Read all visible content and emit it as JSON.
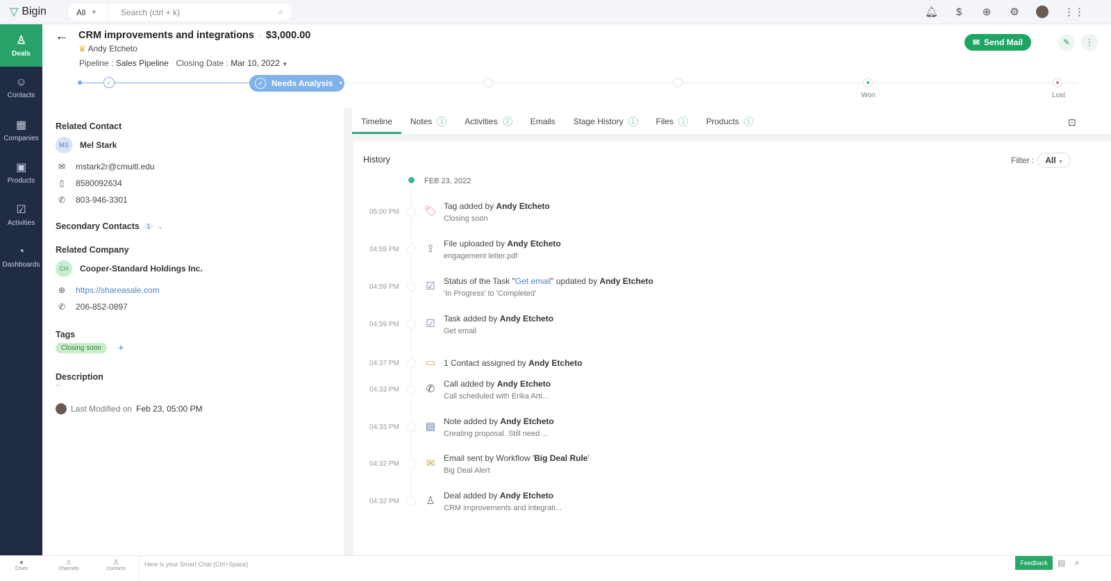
{
  "app": {
    "name": "Bigin",
    "search_scope": "All",
    "search_placeholder": "Search (ctrl + k)"
  },
  "topbar_icons": [
    "bell-icon",
    "currency-icon",
    "add-icon",
    "settings-icon",
    "avatar",
    "apps-grid-icon"
  ],
  "sidebar": {
    "items": [
      {
        "label": "Deals",
        "icon": "deals-icon",
        "active": true
      },
      {
        "label": "Contacts",
        "icon": "contacts-icon"
      },
      {
        "label": "Companies",
        "icon": "companies-icon"
      },
      {
        "label": "Products",
        "icon": "products-icon"
      },
      {
        "label": "Activities",
        "icon": "activities-icon"
      },
      {
        "label": "Dashboards",
        "icon": "dashboards-icon"
      }
    ]
  },
  "deal": {
    "title": "CRM improvements and integrations",
    "amount": "$3,000.00",
    "owner": "Andy Etcheto",
    "pipeline_label": "Pipeline :",
    "pipeline": "Sales Pipeline",
    "closing_label": "Closing Date :",
    "closing_date": "Mar 10, 2022",
    "send_mail": "Send Mail"
  },
  "stages": {
    "current": "Needs Analysis",
    "won": "Won",
    "lost": "Lost",
    "won_color": "#3bb98a",
    "lost_color": "#e46b7e"
  },
  "left": {
    "related_contact": "Related Contact",
    "contact_initials": "MS",
    "contact_name": "Mel Stark",
    "email": "mstark2r@cmuitl.edu",
    "mobile": "8580092634",
    "phone": "803-946-3301",
    "secondary_contacts": "Secondary Contacts",
    "secondary_count": "1",
    "related_company": "Related Company",
    "company_initials": "CH",
    "company_name": "Cooper-Standard Holdings Inc.",
    "website": "https://shareasale.com",
    "company_phone": "206-852-0897",
    "tags_label": "Tags",
    "tag": "Closing soon",
    "description_label": "Description",
    "description": "--",
    "last_modified_label": "Last Modified on",
    "last_modified": "Feb 23, 05:00 PM"
  },
  "tabs": [
    {
      "label": "Timeline",
      "active": true
    },
    {
      "label": "Notes",
      "count": "1"
    },
    {
      "label": "Activities",
      "count": "2"
    },
    {
      "label": "Emails"
    },
    {
      "label": "Stage History",
      "count": "1"
    },
    {
      "label": "Files",
      "count": "1"
    },
    {
      "label": "Products",
      "count": "1"
    }
  ],
  "timeline": {
    "heading": "History",
    "filter_label": "Filter :",
    "filter_value": "All",
    "date": "FEB 23, 2022",
    "entries": [
      {
        "time": "05:00 PM",
        "icon": "tag-icon",
        "pre": "Tag added by ",
        "bold": "Andy Etcheto",
        "sub": "Closing soon"
      },
      {
        "time": "04:59 PM",
        "icon": "file-upload-icon",
        "pre": "File uploaded by ",
        "bold": "Andy Etcheto",
        "sub": "engagement letter.pdf"
      },
      {
        "time": "04:59 PM",
        "icon": "task-icon",
        "pre": "Status of the Task \"",
        "link": "Get email",
        "mid": "\" updated by ",
        "bold": "Andy Etcheto",
        "sub": "'In Progress' to 'Completed'"
      },
      {
        "time": "04:59 PM",
        "icon": "task-icon",
        "pre": "Task added by ",
        "bold": "Andy Etcheto",
        "sub": "Get email"
      },
      {
        "time": "04:37 PM",
        "icon": "contact-card-icon",
        "pre": "1 Contact assigned by ",
        "bold": "Andy Etcheto"
      },
      {
        "time": "04:33 PM",
        "icon": "call-icon",
        "pre": "Call added by ",
        "bold": "Andy Etcheto",
        "sub": "Call scheduled with Erika Arti..."
      },
      {
        "time": "04:33 PM",
        "icon": "note-icon",
        "pre": "Note added by ",
        "bold": "Andy Etcheto",
        "sub": "Creating proposal. Still need ..."
      },
      {
        "time": "04:32 PM",
        "icon": "email-icon",
        "pre": "Email sent by Workflow '",
        "bold": "Big Deal Rule",
        "post": "'",
        "sub": "Big Deal Alert"
      },
      {
        "time": "04:32 PM",
        "icon": "deal-icon",
        "pre": "Deal added by ",
        "bold": "Andy Etcheto",
        "sub": "CRM improvements and integrati..."
      }
    ]
  },
  "bottom": {
    "items": [
      "Chats",
      "Channels",
      "Contacts"
    ],
    "smart_chat": "Here is your Smart Chat (Ctrl+Space)",
    "feedback": "Feedback"
  }
}
